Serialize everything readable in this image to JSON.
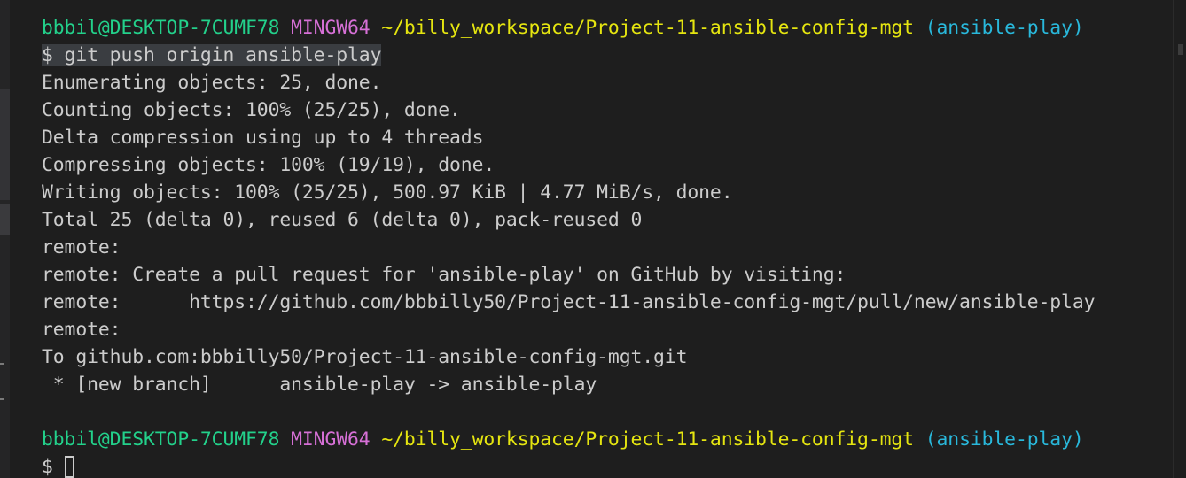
{
  "prompt1": {
    "user_host": "bbbil@DESKTOP-7CUMF78",
    "shell": "MINGW64",
    "path": "~/billy_workspace/Project-11-ansible-config-mgt",
    "branch": "(ansible-play)"
  },
  "command": "$ git push origin ansible-play",
  "output": [
    "Enumerating objects: 25, done.",
    "Counting objects: 100% (25/25), done.",
    "Delta compression using up to 4 threads",
    "Compressing objects: 100% (19/19), done.",
    "Writing objects: 100% (25/25), 500.97 KiB | 4.77 MiB/s, done.",
    "Total 25 (delta 0), reused 6 (delta 0), pack-reused 0",
    "remote:",
    "remote: Create a pull request for 'ansible-play' on GitHub by visiting:",
    "remote:      https://github.com/bbbilly50/Project-11-ansible-config-mgt/pull/new/ansible-play",
    "remote:",
    "To github.com:bbbilly50/Project-11-ansible-config-mgt.git",
    " * [new branch]      ansible-play -> ansible-play"
  ],
  "prompt2": {
    "user_host": "bbbil@DESKTOP-7CUMF78",
    "shell": "MINGW64",
    "path": "~/billy_workspace/Project-11-ansible-config-mgt",
    "branch": "(ansible-play)"
  },
  "input_prompt": "$ ",
  "colors": {
    "background": "#1e1e1e",
    "text": "#cccccc",
    "user_host": "#23d18b",
    "shell": "#d670d6",
    "path": "#e5e510",
    "branch": "#29b8db"
  }
}
